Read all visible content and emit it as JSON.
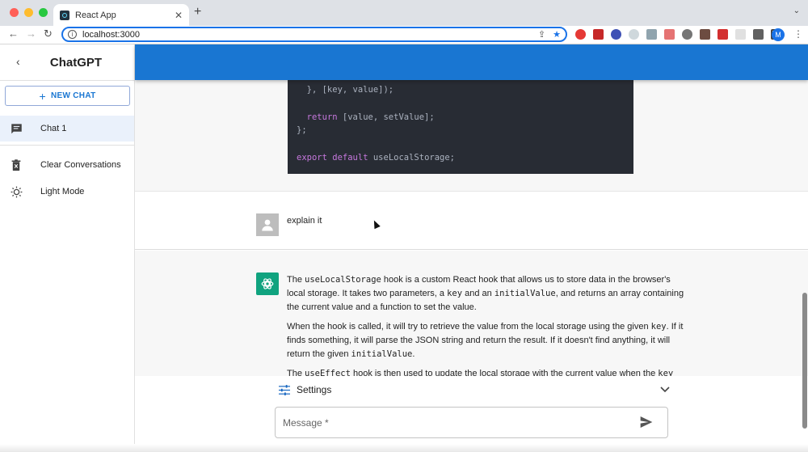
{
  "browser": {
    "tab_title": "React App",
    "tab_close": "✕",
    "new_tab": "+",
    "url": "localhost:3000",
    "avatar_letter": "M",
    "colors": {
      "close": "#ff5f57",
      "minimize": "#febc2e",
      "maximize": "#28c840",
      "focus": "#1a73e8"
    }
  },
  "sidebar": {
    "title": "ChatGPT",
    "new_chat_label": "NEW CHAT",
    "items": [
      {
        "label": "Chat 1"
      },
      {
        "label": "Clear Conversations"
      },
      {
        "label": "Light Mode"
      }
    ]
  },
  "appbar": {
    "color": "#1976d2"
  },
  "code": {
    "lines": [
      "  }, [key, value]);",
      "",
      "  return [value, setValue];",
      "};",
      "",
      "export default useLocalStorage;"
    ]
  },
  "user_message": {
    "text": "explain it"
  },
  "bot_message": {
    "p1": {
      "a": "The ",
      "c1": "useLocalStorage",
      "b": " hook is a custom React hook that allows us to store data in the browser's local storage. It takes two parameters, a ",
      "c2": "key",
      "c": " and an ",
      "c3": "initialValue",
      "d": ", and returns an array containing the current value and a function to set the value."
    },
    "p2": {
      "a": "When the hook is called, it will try to retrieve the value from the local storage using the given ",
      "c1": "key",
      "b": ". If it finds something, it will parse the JSON string and return the result. If it doesn't find anything, it will return the given ",
      "c2": "initialValue",
      "c": "."
    },
    "p3": {
      "a": "The ",
      "c1": "useEffect",
      "b": " hook is then used to update the local storage with the current value when the ",
      "c2": "key"
    }
  },
  "settings": {
    "label": "Settings"
  },
  "message_input": {
    "placeholder": "Message *"
  }
}
